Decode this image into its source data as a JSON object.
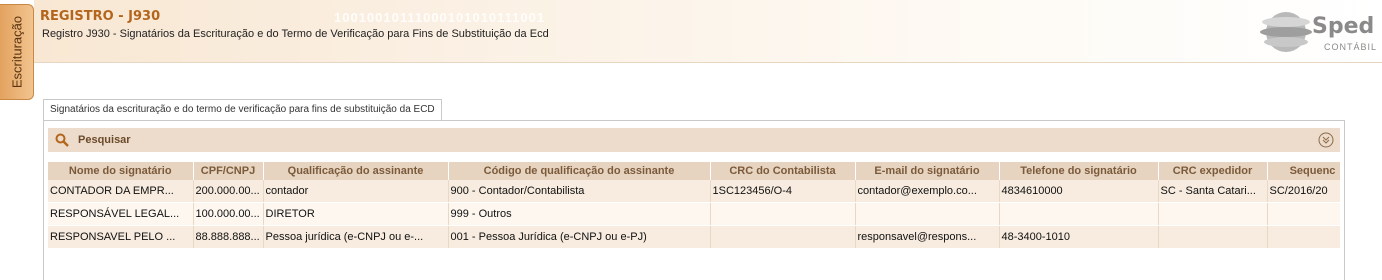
{
  "side_tab": {
    "label": "Escrituração"
  },
  "header": {
    "title": "REGISTRO - J930",
    "subtitle": "Registro J930 - Signatários da Escrituração e do Termo de Verificação para Fins de Substituição da Ecd",
    "binary_text": "10010010111000101010111001",
    "logo_text": "Sped",
    "logo_sub": "CONTÁBIL"
  },
  "tab": {
    "label": "Signatários da escrituração e do termo de verificação para fins de substituição da ECD"
  },
  "search": {
    "label": "Pesquisar",
    "icon": "search-icon",
    "collapse_icon": "double-chevron-down-icon"
  },
  "table": {
    "columns": [
      "Nome do signatário",
      "CPF/CNPJ",
      "Qualificação do assinante",
      "Código de qualificação do assinante",
      "CRC do Contabilista",
      "E-mail do signatário",
      "Telefone do signatário",
      "CRC expedidor",
      "Sequenc"
    ],
    "rows": [
      [
        "CONTADOR DA EMPR...",
        "200.000.00...",
        "contador",
        "900 - Contador/Contabilista",
        "1SC123456/O-4",
        "contador@exemplo.co...",
        "4834610000",
        "SC - Santa Catari...",
        "SC/2016/20"
      ],
      [
        "RESPONSÁVEL LEGAL...",
        "100.000.00...",
        "DIRETOR",
        "999 - Outros",
        "",
        "",
        "",
        "",
        ""
      ],
      [
        "RESPONSAVEL PELO ...",
        "88.888.888...",
        "Pessoa jurídica (e-CNPJ ou e-...",
        "001 - Pessoa Jurídica (e-CNPJ ou e-PJ)",
        "",
        "responsavel@respons...",
        "48-3400-1010",
        "",
        ""
      ]
    ]
  },
  "colors": {
    "accent": "#b4651c",
    "tab_orange": "#e3a25f",
    "header_row": "#e6d4c0",
    "row_bg": "#f7ecdf"
  }
}
